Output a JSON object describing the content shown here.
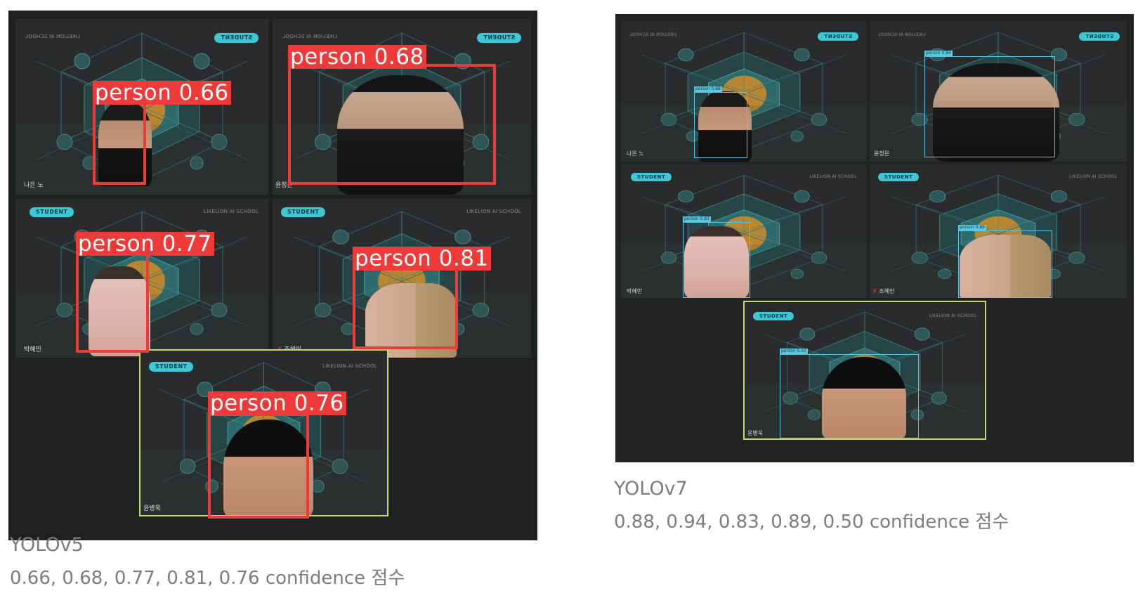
{
  "yolov5": {
    "caption_title": "YOLOv5",
    "caption_scores": "0.66, 0.68, 0.77, 0.81, 0.76 confidence 점수",
    "tiles": [
      {
        "badge": "STUDENT",
        "school": "LIKELION AI SCHOOL",
        "name": "나은 노"
      },
      {
        "badge": "STUDENT",
        "school": "LIKELION AI SCHOOL",
        "name": "윤정은"
      },
      {
        "badge": "STUDENT",
        "school": "LIKELION AI SCHOOL",
        "name": "박혜민"
      },
      {
        "badge": "STUDENT",
        "school": "LIKELION AI SCHOOL",
        "name": "조혜인"
      },
      {
        "badge": "STUDENT",
        "school": "LIKELION AI SCHOOL",
        "name": "윤병욱"
      }
    ],
    "detections": [
      {
        "label": "person 0.66"
      },
      {
        "label": "person 0.68"
      },
      {
        "label": "person 0.77"
      },
      {
        "label": "person 0.81"
      },
      {
        "label": "person 0.76"
      }
    ]
  },
  "yolov7": {
    "caption_title": "YOLOv7",
    "caption_scores": "0.88, 0.94, 0.83, 0.89, 0.50 confidence 점수",
    "tiles": [
      {
        "badge": "STUDENT",
        "school": "LIKELION AI SCHOOL",
        "name": "나은 노"
      },
      {
        "badge": "STUDENT",
        "school": "LIKELION AI SCHOOL",
        "name": "윤정은"
      },
      {
        "badge": "STUDENT",
        "school": "LIKELION AI SCHOOL",
        "name": "박혜민"
      },
      {
        "badge": "STUDENT",
        "school": "LIKELION AI SCHOOL",
        "name": "조혜인"
      },
      {
        "badge": "STUDENT",
        "school": "LIKELION AI SCHOOL",
        "name": "윤병욱"
      }
    ],
    "detections": [
      {
        "label": "person 0.88"
      },
      {
        "label": "person 0.94"
      },
      {
        "label": "person 0.83"
      },
      {
        "label": "person 0.89"
      },
      {
        "label": "person 0.50"
      }
    ]
  },
  "colors": {
    "detection_box_v5": "#ee3a39",
    "detection_box_v7": "#5cc7e0",
    "active_speaker_frame": "#c8d86a",
    "student_badge": "#3fc7d6"
  }
}
